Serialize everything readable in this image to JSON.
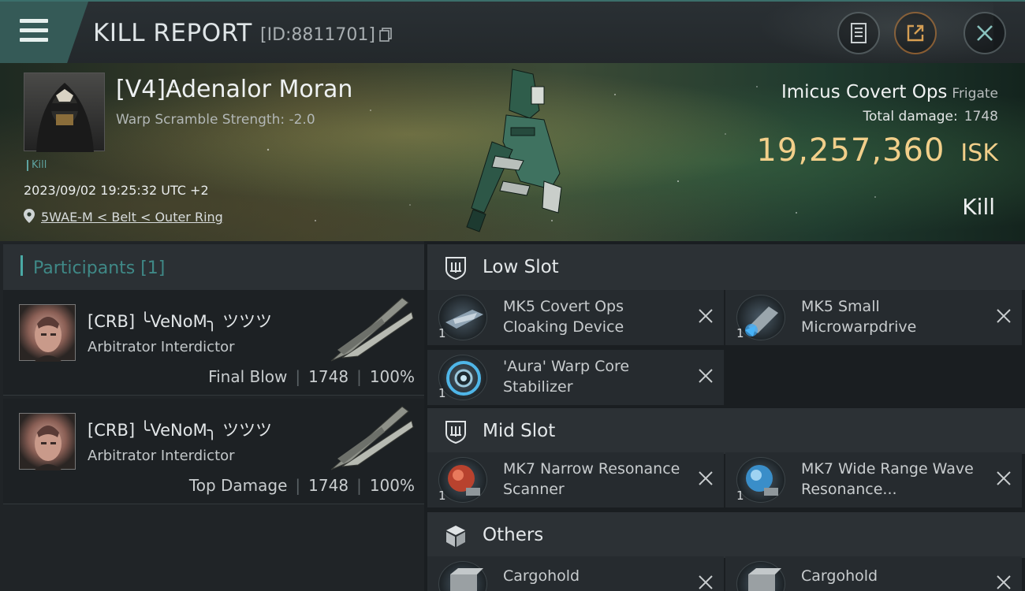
{
  "header": {
    "title": "KILL REPORT",
    "report_id": "[ID:8811701]"
  },
  "victim": {
    "name": "[V4]Adenalor Moran",
    "warp_scramble": "Warp Scramble Strength: -2.0",
    "kill_tag": "Kill",
    "datetime": "2023/09/02 19:25:32 UTC +2",
    "location": "5WAE-M < Belt < Outer Ring",
    "ship_name": "Imicus Covert Ops",
    "ship_class": "Frigate",
    "total_damage_label": "Total damage:",
    "total_damage": "1748",
    "isk_value": "19,257,360",
    "isk_unit": "ISK",
    "result": "Kill"
  },
  "participants": {
    "title": "Participants [1]",
    "cards": [
      {
        "name": "[CRB] ╰VeNoM╮ ツツツ",
        "ship": "Arbitrator Interdictor",
        "role": "Final Blow",
        "damage": "1748",
        "percent": "100%"
      },
      {
        "name": "[CRB] ╰VeNoM╮ ツツツ",
        "ship": "Arbitrator Interdictor",
        "role": "Top Damage",
        "damage": "1748",
        "percent": "100%"
      }
    ]
  },
  "fitting": {
    "low_slot": {
      "title": "Low Slot",
      "modules": [
        {
          "qty": "1",
          "name": "MK5 Covert Ops Cloaking Device"
        },
        {
          "qty": "1",
          "name": "MK5 Small Microwarpdrive"
        },
        {
          "qty": "1",
          "name": "'Aura' Warp Core Stabilizer"
        }
      ]
    },
    "mid_slot": {
      "title": "Mid Slot",
      "modules": [
        {
          "qty": "1",
          "name": "MK7 Narrow Resonance Scanner"
        },
        {
          "qty": "1",
          "name": "MK7 Wide Range Wave Resonance..."
        }
      ]
    },
    "others": {
      "title": "Others",
      "modules": [
        {
          "qty": "",
          "name": "Cargohold"
        },
        {
          "qty": "",
          "name": "Cargohold"
        }
      ]
    }
  },
  "colors": {
    "accent_teal": "#4aa9a5",
    "isk_gold": "#f2cf8a",
    "header_tab": "#355a57",
    "orange_button": "#8a5a2c"
  },
  "icons": [
    "menu-icon",
    "copy-icon",
    "document-icon",
    "share-icon",
    "close-icon",
    "location-pin-icon",
    "low-slot-icon",
    "mid-slot-icon",
    "cube-icon",
    "remove-icon"
  ]
}
